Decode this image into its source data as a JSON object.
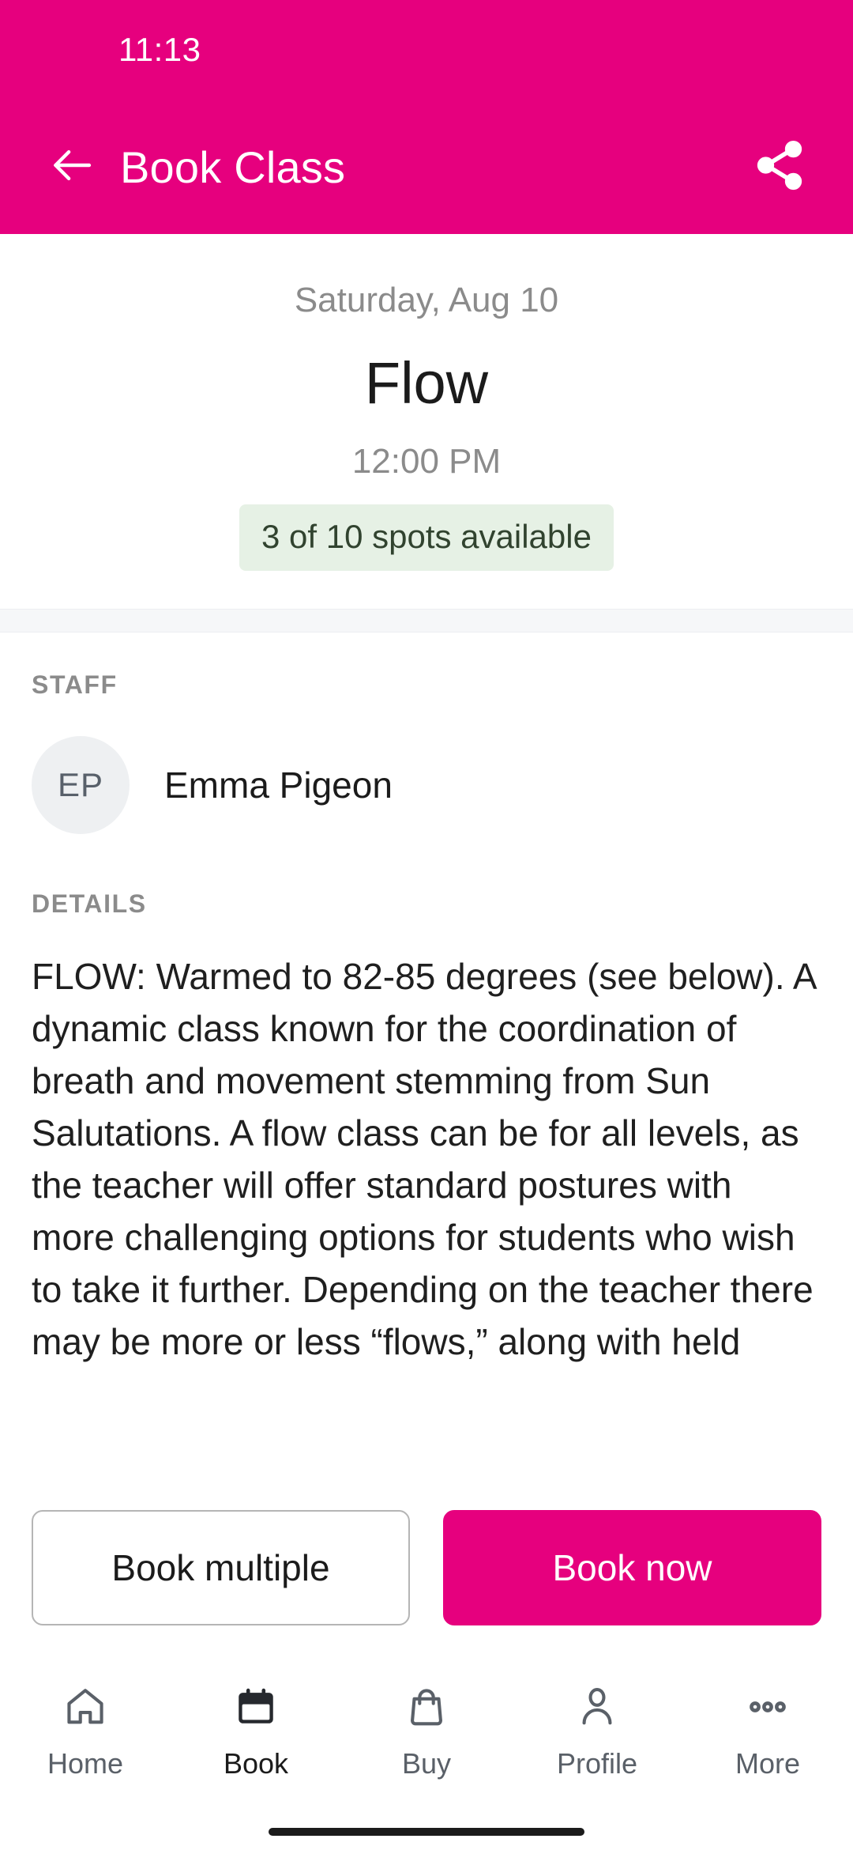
{
  "theme": {
    "brand_pink": "#e6007e",
    "badge_green_bg": "#e6f1e5",
    "badge_green_text": "#31432f",
    "avatar_bg": "#eef0f2",
    "muted_text": "#8b8b8b"
  },
  "status_bar": {
    "time": "11:13"
  },
  "app_bar": {
    "title": "Book Class",
    "back_icon": "arrow-left-icon",
    "share_icon": "share-icon"
  },
  "class_summary": {
    "date": "Saturday, Aug 10",
    "name": "Flow",
    "time": "12:00 PM",
    "spots": "3 of 10 spots available",
    "spots_open": 3,
    "spots_total": 10
  },
  "staff_section": {
    "label": "STAFF",
    "members": [
      {
        "initials": "EP",
        "name": "Emma Pigeon"
      }
    ]
  },
  "details_section": {
    "label": "DETAILS",
    "body": "FLOW: Warmed to 82-85 degrees (see below). A dynamic class known for the coordination of breath and movement stemming from Sun Salutations. A flow class can be for all levels, as the teacher will offer standard postures with more challenging options for students who wish to take it further. Depending on the teacher there may be more or less “flows,” along with held"
  },
  "actions": {
    "secondary_label": "Book multiple",
    "primary_label": "Book now"
  },
  "bottom_nav": {
    "active_index": 1,
    "items": [
      {
        "label": "Home",
        "icon": "home-icon"
      },
      {
        "label": "Book",
        "icon": "calendar-icon"
      },
      {
        "label": "Buy",
        "icon": "shopping-bag-icon"
      },
      {
        "label": "Profile",
        "icon": "person-icon"
      },
      {
        "label": "More",
        "icon": "ellipsis-icon"
      }
    ]
  }
}
